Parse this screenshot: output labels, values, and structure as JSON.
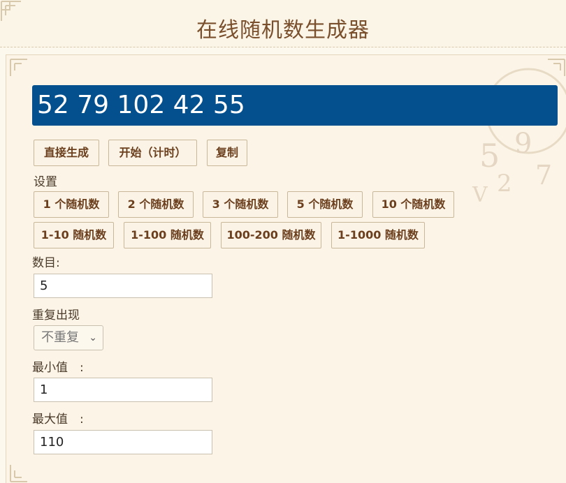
{
  "page_title": "在线随机数生成器",
  "result": "52 79 102 42 55",
  "actions": {
    "generate": "直接生成",
    "start_timed": "开始（计时）",
    "copy": "复制"
  },
  "settings_label": "设置",
  "presets_row1": [
    "1 个随机数",
    "2 个随机数",
    "3 个随机数",
    "5 个随机数",
    "10 个随机数"
  ],
  "presets_row2": [
    "1-10 随机数",
    "1-100 随机数",
    "100-200 随机数",
    "1-1000 随机数"
  ],
  "count": {
    "label": "数目:",
    "value": "5"
  },
  "repeat": {
    "label": "重复出现",
    "selected": "不重复"
  },
  "min": {
    "label": "最小值　:",
    "value": "1"
  },
  "max": {
    "label": "最大值　:",
    "value": "110"
  },
  "colors": {
    "result_bg": "#04508f",
    "button_text": "#6b3f1d",
    "title": "#7a4f2c"
  },
  "icons": [
    "chevron-down-icon",
    "corner-ornament-icon",
    "numbers-watermark-icon"
  ]
}
